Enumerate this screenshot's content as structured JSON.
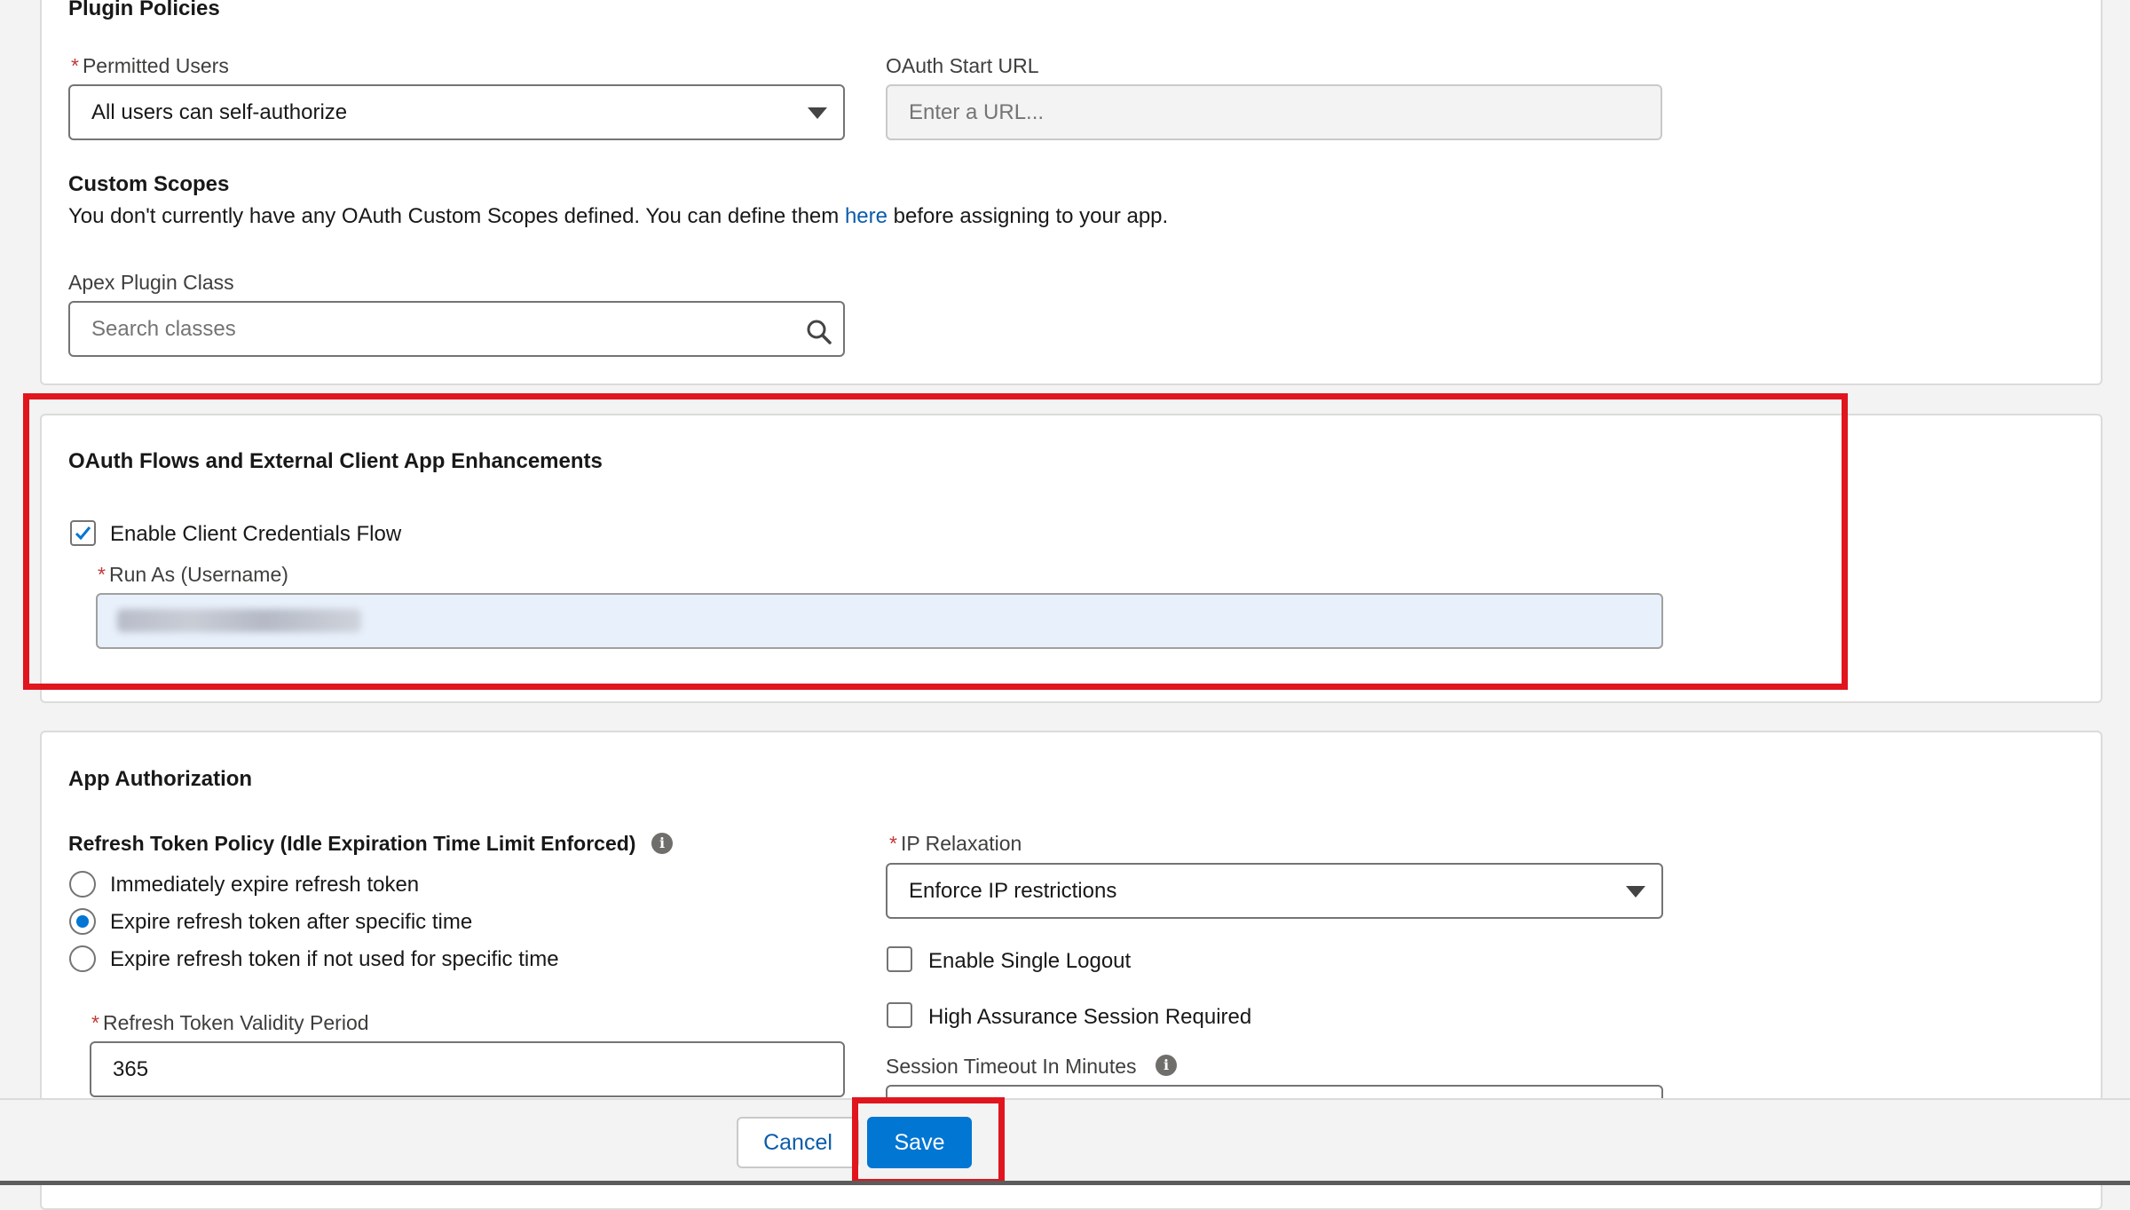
{
  "plugin_policies": {
    "title": "Plugin Policies",
    "permitted_users": {
      "label": "Permitted Users",
      "required_mark": "*",
      "value": "All users can self-authorize"
    },
    "oauth_start_url": {
      "label": "OAuth Start URL",
      "placeholder": "Enter a URL..."
    },
    "custom_scopes": {
      "title": "Custom Scopes",
      "text_before": "You don't currently have any OAuth Custom Scopes defined. You can define them",
      "link": "here",
      "text_after": "before assigning to your app."
    },
    "apex_plugin_class": {
      "label": "Apex Plugin Class",
      "placeholder": "Search classes",
      "icon": "search-icon"
    }
  },
  "oauth_flows": {
    "title": "OAuth Flows and External Client App Enhancements",
    "client_credentials": {
      "label": "Enable Client Credentials Flow",
      "checked": true
    },
    "run_as": {
      "label": "Run As (Username)",
      "required_mark": "*"
    }
  },
  "app_authorization": {
    "title": "App Authorization",
    "refresh_token_policy": {
      "label": "Refresh Token Policy (Idle Expiration Time Limit Enforced)",
      "options": [
        {
          "label": "Immediately expire refresh token",
          "selected": false
        },
        {
          "label": "Expire refresh token after specific time",
          "selected": true
        },
        {
          "label": "Expire refresh token if not used for specific time",
          "selected": false
        }
      ]
    },
    "refresh_token_validity": {
      "label": "Refresh Token Validity Period",
      "required_mark": "*",
      "value": "365"
    },
    "ip_relaxation": {
      "label": "IP Relaxation",
      "required_mark": "*",
      "value": "Enforce IP restrictions"
    },
    "single_logout": {
      "label": "Enable Single Logout",
      "checked": false
    },
    "high_assurance": {
      "label": "High Assurance Session Required",
      "checked": false
    },
    "session_timeout": {
      "label": "Session Timeout In Minutes"
    },
    "info_icon_glyph": "i"
  },
  "footer": {
    "cancel": "Cancel",
    "save": "Save"
  },
  "colors": {
    "brand": "#0176d3",
    "highlight": "#e0151e",
    "link": "#0b5cab",
    "required": "#c23934"
  }
}
